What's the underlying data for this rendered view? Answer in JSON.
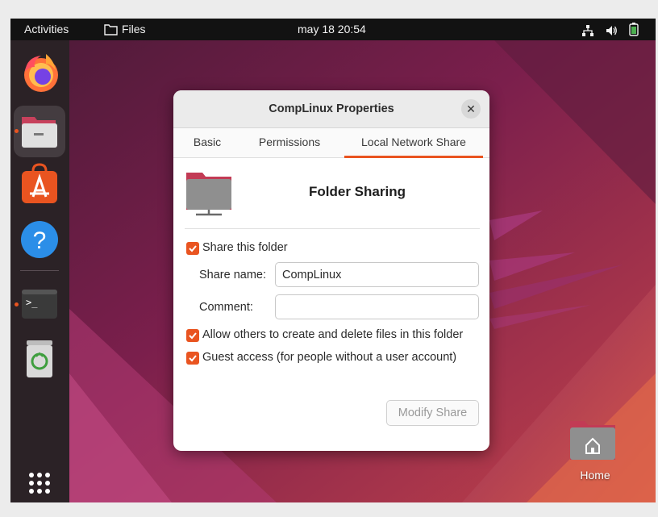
{
  "topbar": {
    "activities": "Activities",
    "app_menu": "Files",
    "clock": "may 18  20:54",
    "icons": [
      "network-icon",
      "volume-icon",
      "battery-icon"
    ]
  },
  "dock": {
    "apps": [
      "firefox",
      "files",
      "app-center",
      "help",
      "terminal",
      "trash"
    ],
    "running": [
      "files",
      "terminal"
    ],
    "show_apps": "grid-icon"
  },
  "desktop": {
    "home_label": "Home"
  },
  "dialog": {
    "title": "CompLinux Properties",
    "tabs": [
      "Basic",
      "Permissions",
      "Local Network Share"
    ],
    "active_tab": "Local Network Share",
    "heading": "Folder Sharing",
    "share_folder_label": "Share this folder",
    "share_folder_checked": true,
    "share_name_label": "Share name:",
    "share_name_value": "CompLinux",
    "comment_label": "Comment:",
    "comment_value": "",
    "allow_others_label": "Allow others to create and delete files in this folder",
    "allow_others_checked": true,
    "guest_label": "Guest access (for people without a user account)",
    "guest_checked": true,
    "modify_button": "Modify Share"
  },
  "colors": {
    "accent": "#e95420",
    "topbar": "#121212",
    "dock": "#2b2226",
    "wallpaper": "#8a1f4d"
  }
}
